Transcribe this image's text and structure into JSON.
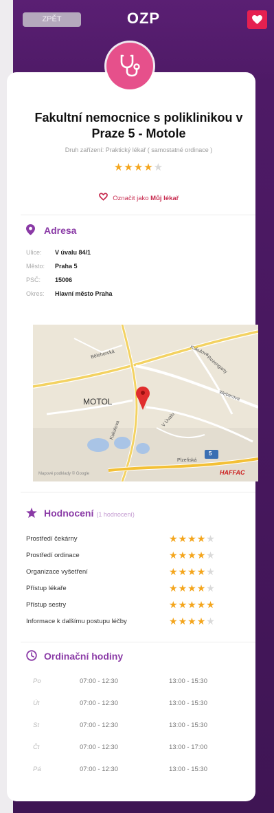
{
  "header": {
    "back_label": "ZPĚT",
    "logo": "OZP"
  },
  "facility": {
    "name_line1": "Fakultní nemocnice s poliklinikou v",
    "name_line2": "Praze 5 - Motole",
    "type_text": "Druh zařízení: Praktický lékař ( samostatné ordinace )",
    "rating_stars": 4,
    "rating_max": 5
  },
  "mark": {
    "prefix": "Označit jako",
    "label": "Můj lékař"
  },
  "address": {
    "heading": "Adresa",
    "rows": [
      {
        "label": "Ulice:",
        "value": "V úvalu 84/1"
      },
      {
        "label": "Město:",
        "value": "Praha 5"
      },
      {
        "label": "PSČ:",
        "value": "15006"
      },
      {
        "label": "Okres:",
        "value": "Hlavní město Praha"
      }
    ]
  },
  "map": {
    "labels": {
      "district": "MOTOL",
      "road1": "Bělohorská",
      "road2": "Kukulova",
      "road3": "Rozengarty",
      "road4": "Weberova",
      "road5": "Plzeňská",
      "road6": "V Úvalu",
      "road7": "Kukulova"
    },
    "route_number": "5",
    "attribution": "Mapové podklady © Google",
    "brand": "HAFFAC"
  },
  "ratings": {
    "heading": "Hodnocení",
    "count_text": "(1 hodnocení)",
    "items": [
      {
        "name": "Prostředí čekárny",
        "stars": 4
      },
      {
        "name": "Prostředí ordinace",
        "stars": 4
      },
      {
        "name": "Organizace vyšetření",
        "stars": 4
      },
      {
        "name": "Přístup lékaře",
        "stars": 4
      },
      {
        "name": "Přístup sestry",
        "stars": 5
      },
      {
        "name": "Informace k dalšímu postupu léčby",
        "stars": 4
      }
    ]
  },
  "hours": {
    "heading": "Ordinační hodiny",
    "rows": [
      {
        "day": "Po",
        "am": "07:00 - 12:30",
        "pm": "13:00 - 15:30"
      },
      {
        "day": "Út",
        "am": "07:00 - 12:30",
        "pm": "13:00 - 15:30"
      },
      {
        "day": "St",
        "am": "07:00 - 12:30",
        "pm": "13:00 - 15:30"
      },
      {
        "day": "Čt",
        "am": "07:00 - 12:30",
        "pm": "13:00 - 17:00"
      },
      {
        "day": "Pá",
        "am": "07:00 - 12:30",
        "pm": "13:00 - 15:30"
      }
    ]
  },
  "colors": {
    "brand_purple": "#5a1f73",
    "accent_pink": "#e6508b",
    "heart_red": "#e52050",
    "star_gold": "#f4a51c",
    "section_purple": "#8a3aa6"
  }
}
